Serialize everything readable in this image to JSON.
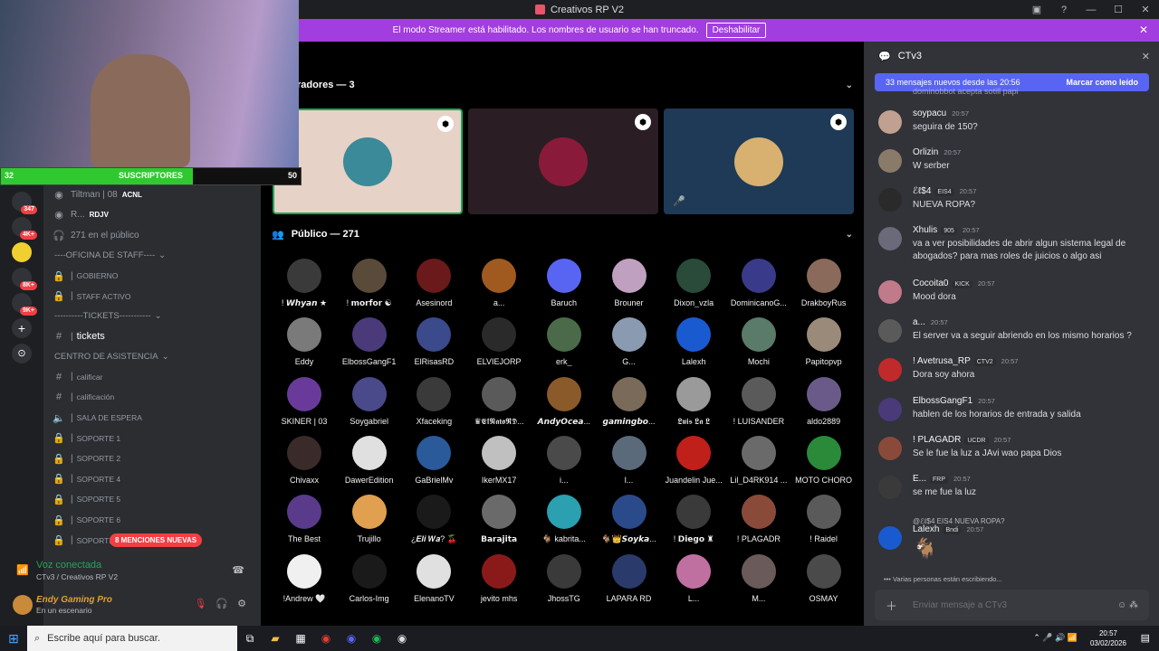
{
  "window": {
    "title": "Creativos RP V2"
  },
  "streamer_banner": {
    "text": "El modo Streamer está habilitado. Los nombres de usuario se han truncado.",
    "button": "Deshabilitar"
  },
  "overlay": {
    "subs_current": "32",
    "subs_label": "SUSCRIPTORES",
    "subs_goal": "50"
  },
  "server_badges": [
    "347",
    "4K+",
    "8K+",
    "9K+"
  ],
  "channels": {
    "top_users": [
      {
        "name": "Tiltman | 08",
        "tag": "ACNL"
      },
      {
        "name": "R...",
        "tag": "RDJV"
      }
    ],
    "audience": "271 en el público",
    "items": [
      {
        "kind": "cat",
        "label": "----OFICINA DE STAFF----"
      },
      {
        "kind": "lock",
        "label": "GOBIERNO"
      },
      {
        "kind": "lock",
        "label": "STAFF ACTIVO"
      },
      {
        "kind": "cat",
        "label": "----------TICKETS-----------"
      },
      {
        "kind": "hash",
        "label": "tickets"
      },
      {
        "kind": "cat",
        "label": "CENTRO DE ASISTENCIA"
      },
      {
        "kind": "hash",
        "label": "calificar"
      },
      {
        "kind": "hash",
        "label": "calificación"
      },
      {
        "kind": "speaker",
        "label": "SALA DE ESPERA"
      },
      {
        "kind": "lock",
        "label": "SOPORTE 1"
      },
      {
        "kind": "lock",
        "label": "SOPORTE 2"
      },
      {
        "kind": "lock",
        "label": "SOPORTE 4"
      },
      {
        "kind": "lock",
        "label": "SOPORTE 5"
      },
      {
        "kind": "lock",
        "label": "SOPORTE 6"
      },
      {
        "kind": "lock",
        "label": "SOPORTE 7"
      }
    ],
    "mentions": "8 MENCIONES NUEVAS"
  },
  "voice": {
    "status": "Voz conectada",
    "location": "CTv3 / Creativos RP V2"
  },
  "user": {
    "name": "Endy Gaming Pro",
    "status": "En un escenario"
  },
  "stage": {
    "speakers_header": "radores — 3",
    "public_header": "Público — 271",
    "audience": [
      {
        "name": "! 𝙒𝙝𝙮𝙖𝙣 ★",
        "color": "#3a3a3a"
      },
      {
        "name": "! 𝗺𝗼𝗿𝗳𝗼𝗿 ☯",
        "color": "#5a4a3a"
      },
      {
        "name": "Asesinord",
        "color": "#6a1a1a"
      },
      {
        "name": "a...",
        "color": "#a05a20"
      },
      {
        "name": "Baruch",
        "color": "#5865f2"
      },
      {
        "name": "Brouner",
        "color": "#c0a0c0"
      },
      {
        "name": "Dixon_vzla",
        "color": "#2a4a3a"
      },
      {
        "name": "DominicanoG...",
        "color": "#3a3a8a"
      },
      {
        "name": "DrakboyRus",
        "color": "#8a6a5a"
      },
      {
        "name": "Eddy",
        "color": "#7a7a7a"
      },
      {
        "name": "ElbossGangF1",
        "color": "#4a3a7a"
      },
      {
        "name": "ElRisasRD",
        "color": "#3a4a8a"
      },
      {
        "name": "ELVIEJORP",
        "color": "#2a2a2a"
      },
      {
        "name": "erk_",
        "color": "#4a6a4a"
      },
      {
        "name": "G...",
        "color": "#8a9ab0"
      },
      {
        "name": "Lalexh",
        "color": "#1a5ad0"
      },
      {
        "name": "Mochi",
        "color": "#5a7a6a"
      },
      {
        "name": "Papitopvp",
        "color": "#9a8a7a"
      },
      {
        "name": "SKINER | 03",
        "color": "#6a3a9a"
      },
      {
        "name": "Soygabriel",
        "color": "#4a4a8a"
      },
      {
        "name": "Xfaceking",
        "color": "#3a3a3a"
      },
      {
        "name": "♛𝕰𝖑𝕹𝖆𝖙𝖔𝕽𝕯...",
        "color": "#5a5a5a"
      },
      {
        "name": "𝘼𝙣𝙙𝙮𝙊𝙘𝙚𝙖...",
        "color": "#8a5a2a"
      },
      {
        "name": "𝙜𝙖𝙢𝙞𝙣𝙜𝙗𝙤...",
        "color": "#7a6a5a"
      },
      {
        "name": "𝕷𝖚𝖎𝖘 𝕷𝖆 𝕷",
        "color": "#9a9a9a"
      },
      {
        "name": "! LUISANDER",
        "color": "#5a5a5a"
      },
      {
        "name": "aldo2889",
        "color": "#6a5a8a"
      },
      {
        "name": "Chivaxx",
        "color": "#3a2a2a"
      },
      {
        "name": "DawerEdition",
        "color": "#e0e0e0"
      },
      {
        "name": "GaBrielMv",
        "color": "#2a5a9a"
      },
      {
        "name": "IkerMX17",
        "color": "#c0c0c0"
      },
      {
        "name": "i...",
        "color": "#4a4a4a"
      },
      {
        "name": "l...",
        "color": "#5a6a7a"
      },
      {
        "name": "Juandelin Jue...",
        "color": "#c0201a"
      },
      {
        "name": "Lil_D4RK914 ...",
        "color": "#6a6a6a"
      },
      {
        "name": "MOTO CHORO",
        "color": "#2a8a3a"
      },
      {
        "name": "The Best",
        "color": "#5a3a8a"
      },
      {
        "name": "Trujillo",
        "color": "#e0a050"
      },
      {
        "name": "¿𝑬𝒍𝒊 𝑾𝒂? 🍒",
        "color": "#1a1a1a"
      },
      {
        "name": "𝗕𝗮𝗿𝗮𝗷𝗶𝘁𝗮",
        "color": "#6a6a6a"
      },
      {
        "name": "🐐 kabrita...",
        "color": "#2aa0b0"
      },
      {
        "name": "🐐👑𝙎𝙤𝙮𝙠𝙖...",
        "color": "#2a4a8a"
      },
      {
        "name": "! 𝗗𝗶𝗲𝗴𝗼 ♜",
        "color": "#3a3a3a"
      },
      {
        "name": "! PLAGADR",
        "color": "#8a4a3a"
      },
      {
        "name": "! Raidel",
        "color": "#5a5a5a"
      },
      {
        "name": "!Andrew 🤍",
        "color": "#f0f0f0"
      },
      {
        "name": "Carlos-Img",
        "color": "#1a1a1a"
      },
      {
        "name": "ElenanoTV",
        "color": "#e0e0e0"
      },
      {
        "name": "jevito mhs",
        "color": "#8a1a1a"
      },
      {
        "name": "JhossTG",
        "color": "#3a3a3a"
      },
      {
        "name": "LAPARA RD",
        "color": "#2a3a6a"
      },
      {
        "name": "L...",
        "color": "#c070a0"
      },
      {
        "name": "M...",
        "color": "#6a5a5a"
      },
      {
        "name": "OSMAY",
        "color": "#4a4a4a"
      }
    ]
  },
  "chat": {
    "channel": "CTv3",
    "new_messages": "33 mensajes nuevos desde las 20:56",
    "mark_read": "Marcar como leído",
    "partial_top": "dominobbot acepta sotill papi",
    "messages": [
      {
        "user": "soypacu",
        "time": "20:57",
        "tag": "",
        "text": "seguira de 150?",
        "color": "#c0a090"
      },
      {
        "user": "Orlizin",
        "time": "20:57",
        "tag": "",
        "text": "W serber",
        "color": "#8a7a6a"
      },
      {
        "user": "ℰℓ$4",
        "time": "20:57",
        "tag": "EIS4",
        "text": "NUEVA ROPA?",
        "color": "#2a2a2a"
      },
      {
        "user": "Xhulis",
        "time": "20:57",
        "tag": "905",
        "text": "va a ver posibilidades de abrir algun sistema legal de abogados? para mas roles de juicios o algo asi",
        "color": "#6a6a7a"
      },
      {
        "user": "Cocoita0",
        "time": "20:57",
        "tag": "KICK",
        "text": "Mood dora",
        "color": "#c07a8a"
      },
      {
        "user": "a...",
        "time": "20:57",
        "tag": "",
        "text": "El server va a seguir abriendo en los mismo horarios ?",
        "color": "#5a5a5a"
      },
      {
        "user": "! Avetrusa_RP",
        "time": "20:57",
        "tag": "CTV2",
        "text": "Dora soy ahora",
        "color": "#c02a2a"
      },
      {
        "user": "ElbossGangF1",
        "time": "20:57",
        "tag": "",
        "text": "hablen de los horarios de entrada y  salida",
        "color": "#4a3a7a"
      },
      {
        "user": "! PLAGADR",
        "time": "20:57",
        "tag": "UCDR",
        "text": "Se le fue la luz a JAvi wao papa Dios",
        "color": "#8a4a3a"
      },
      {
        "user": "E...",
        "time": "20:57",
        "tag": "FRP",
        "text": "se me fue la luz",
        "color": "#3a3a3a"
      },
      {
        "user": "Lalexh",
        "time": "20:57",
        "tag": "Bndi",
        "text": "🐐",
        "color": "#1a5ad0"
      }
    ],
    "reply_preview": "@ℰℓ$4  EIS4  NUEVA ROPA?",
    "typing": "Varias personas están escribiendo...",
    "input_placeholder": "Enviar mensaje a CTv3"
  },
  "taskbar": {
    "search": "Escribe aquí para buscar.",
    "time": "20:57",
    "date": "03/02/2026"
  }
}
